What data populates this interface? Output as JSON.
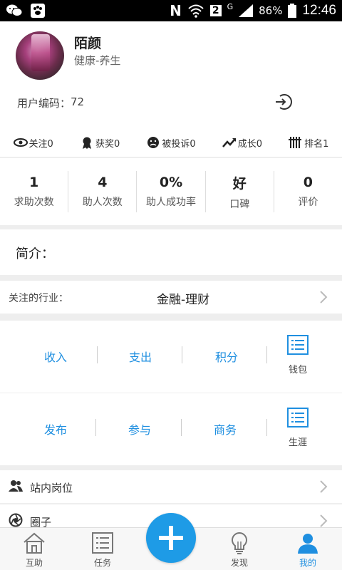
{
  "status_bar": {
    "battery": "86%",
    "time": "12:46",
    "sim_badge": "2",
    "network": "G",
    "carrier_letter": "N"
  },
  "profile": {
    "name": "陌颜",
    "tag": "健康-养生",
    "user_code_label": "用户编码：",
    "user_code_value": "72"
  },
  "stats_icons": [
    {
      "label": "关注0",
      "icon": "eye-icon"
    },
    {
      "label": "获奖0",
      "icon": "award-icon"
    },
    {
      "label": "被投诉0",
      "icon": "sad-face-icon"
    },
    {
      "label": "成长0",
      "icon": "trend-icon"
    },
    {
      "label": "排名1",
      "icon": "ranking-icon"
    }
  ],
  "numbers": [
    {
      "value": "1",
      "label": "求助次数"
    },
    {
      "value": "4",
      "label": "助人次数"
    },
    {
      "value": "0%",
      "label": "助人成功率"
    },
    {
      "value": "好",
      "label": "口碑"
    },
    {
      "value": "0",
      "label": "评价"
    }
  ],
  "intro": {
    "label": "简介："
  },
  "industry": {
    "label": "关注的行业：",
    "value": "金融-理财"
  },
  "wallet": {
    "items": [
      "收入",
      "支出",
      "积分"
    ],
    "side_label": "钱包"
  },
  "career": {
    "items": [
      "发布",
      "参与",
      "商务"
    ],
    "side_label": "生涯"
  },
  "list": [
    {
      "label": "站内岗位",
      "icon": "people-icon"
    },
    {
      "label": "圈子",
      "icon": "aperture-icon"
    }
  ],
  "bottom_nav": [
    {
      "label": "互助",
      "icon": "home-icon"
    },
    {
      "label": "任务",
      "icon": "list-icon"
    },
    {
      "label": "发现",
      "icon": "bulb-icon"
    },
    {
      "label": "我的",
      "icon": "person-icon"
    }
  ],
  "colors": {
    "accent": "#1f8fe0",
    "fab": "#1e9be6"
  }
}
